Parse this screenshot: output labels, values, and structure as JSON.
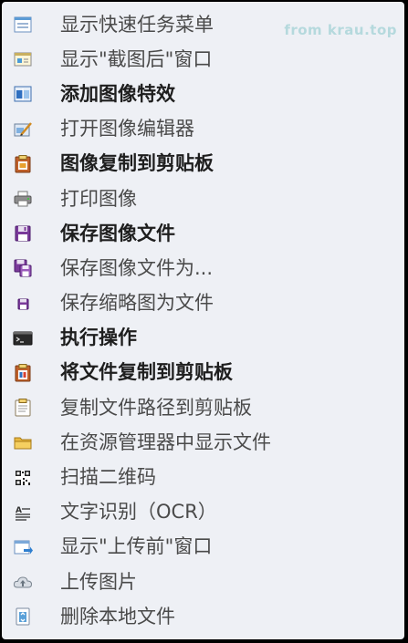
{
  "watermark": "from krau.top",
  "menu": {
    "items": [
      {
        "label": "显示快速任务菜单",
        "bold": false,
        "icon": "quick-task-menu-icon"
      },
      {
        "label": "显示\"截图后\"窗口",
        "bold": false,
        "icon": "after-capture-window-icon"
      },
      {
        "label": "添加图像特效",
        "bold": true,
        "icon": "image-effects-icon"
      },
      {
        "label": "打开图像编辑器",
        "bold": false,
        "icon": "image-editor-icon"
      },
      {
        "label": "图像复制到剪贴板",
        "bold": true,
        "icon": "copy-image-clipboard-icon"
      },
      {
        "label": "打印图像",
        "bold": false,
        "icon": "printer-icon"
      },
      {
        "label": "保存图像文件",
        "bold": true,
        "icon": "save-icon"
      },
      {
        "label": "保存图像文件为...",
        "bold": false,
        "icon": "save-as-icon"
      },
      {
        "label": "保存缩略图为文件",
        "bold": false,
        "icon": "save-thumbnail-icon"
      },
      {
        "label": "执行操作",
        "bold": true,
        "icon": "terminal-icon"
      },
      {
        "label": "将文件复制到剪贴板",
        "bold": true,
        "icon": "copy-file-clipboard-icon"
      },
      {
        "label": "复制文件路径到剪贴板",
        "bold": false,
        "icon": "copy-path-clipboard-icon"
      },
      {
        "label": "在资源管理器中显示文件",
        "bold": false,
        "icon": "folder-icon"
      },
      {
        "label": "扫描二维码",
        "bold": false,
        "icon": "qr-code-icon"
      },
      {
        "label": "文字识别（OCR）",
        "bold": false,
        "icon": "ocr-icon"
      },
      {
        "label": "显示\"上传前\"窗口",
        "bold": false,
        "icon": "before-upload-window-icon"
      },
      {
        "label": "上传图片",
        "bold": false,
        "icon": "cloud-upload-icon"
      },
      {
        "label": "删除本地文件",
        "bold": false,
        "icon": "delete-file-icon"
      }
    ]
  }
}
